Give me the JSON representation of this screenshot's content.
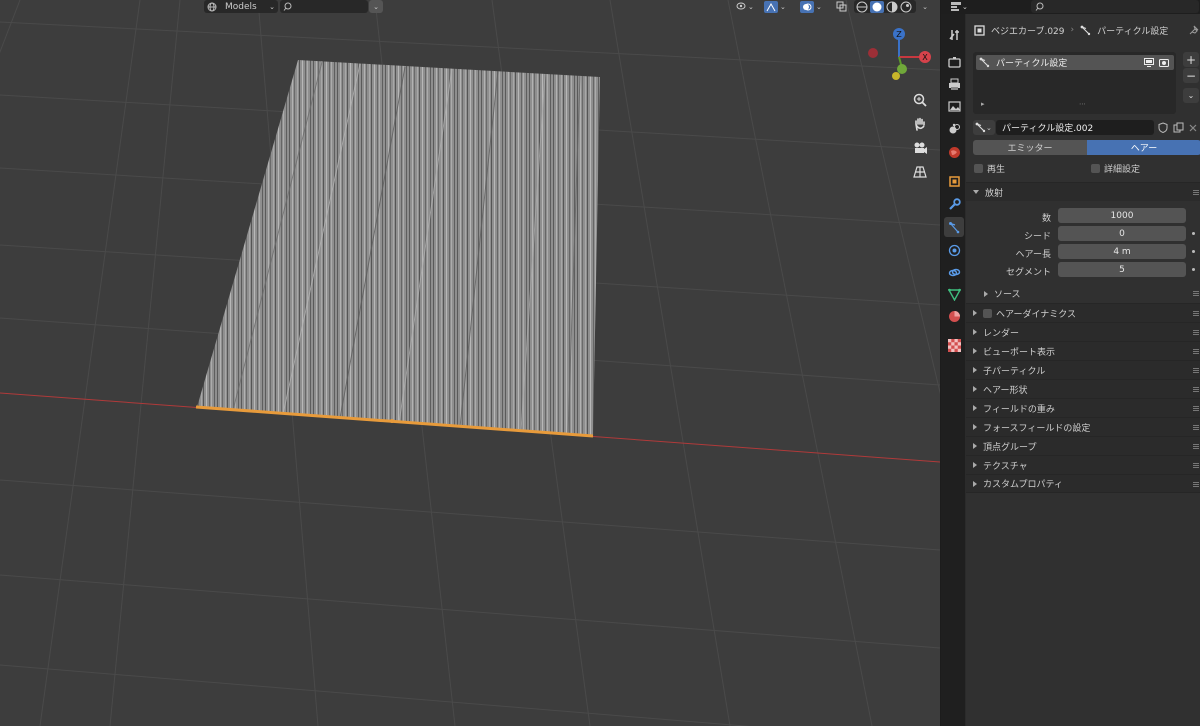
{
  "viewport_header": {
    "collection_label": "Models",
    "search_placeholder": ""
  },
  "gizmo": {
    "x_label": "X",
    "z_label": "Z"
  },
  "properties": {
    "breadcrumb": {
      "object_name": "ベジエカーブ.029",
      "separator": "›",
      "context": "パーティクル設定"
    },
    "particle_systems_list": {
      "items": [
        {
          "name": "パーティクル設定"
        }
      ]
    },
    "settings_datablock": {
      "name": "パーティクル設定.002"
    },
    "type_selector": {
      "options": [
        "エミッター",
        "ヘアー"
      ],
      "selected": "ヘアー"
    },
    "checkboxes": {
      "regrow": "再生",
      "advanced": "詳細設定"
    },
    "emission": {
      "title": "放射",
      "fields": [
        {
          "label": "数",
          "value": "1000"
        },
        {
          "label": "シード",
          "value": "0"
        },
        {
          "label": "ヘアー長",
          "value": "4 m"
        },
        {
          "label": "セグメント",
          "value": "5"
        }
      ],
      "source_label": "ソース"
    },
    "panels": [
      {
        "label": "ヘアーダイナミクス",
        "checkbox": true
      },
      {
        "label": "レンダー"
      },
      {
        "label": "ビューポート表示"
      },
      {
        "label": "子パーティクル"
      },
      {
        "label": "ヘアー形状"
      },
      {
        "label": "フィールドの重み"
      },
      {
        "label": "フォースフィールドの設定"
      },
      {
        "label": "頂点グループ"
      },
      {
        "label": "テクスチャ"
      },
      {
        "label": "カスタムプロパティ"
      }
    ]
  },
  "colors": {
    "viewport_bg": "#3d3d3d",
    "grid_line": "#4a4a4a",
    "x_axis": "#b03a3a",
    "hair": "#9a9a9a",
    "selection_orange": "#e89b3b",
    "accent_blue": "#4772b3",
    "panel_bg": "#303030"
  }
}
